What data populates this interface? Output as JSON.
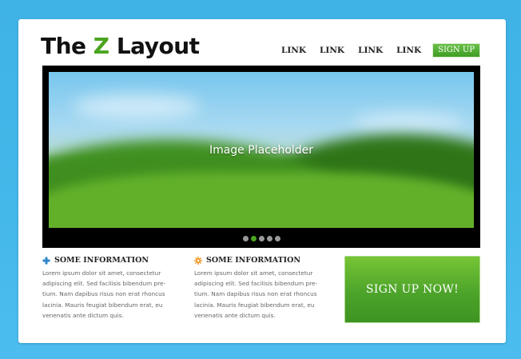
{
  "header": {
    "logo_prefix": "The ",
    "logo_accent": "Z",
    "logo_suffix": " Layout"
  },
  "nav": {
    "links": [
      "LINK",
      "LINK",
      "LINK",
      "LINK"
    ],
    "signup_label": "SIGN UP"
  },
  "slider": {
    "caption": "Image Placeholder",
    "dot_count": 5,
    "active_dot_index": 1
  },
  "info": [
    {
      "icon": "plus-icon",
      "title": "SOME INFORMATION",
      "body": "Lorem ipsum dolor sit amet, consectetur adipiscing elit. Sed facilisis bibendum pre-tium. Nam dapibus risus non erat rhoncus lacinia. Mauris feugiat bibendum erat, eu venenatis ante dictum quis."
    },
    {
      "icon": "gear-icon",
      "title": "SOME INFORMATION",
      "body": "Lorem ipsum dolor sit amet, consectetur adipiscing elit. Sed facilisis bibendum pre-tium. Nam dapibus risus non erat rhoncus lacinia. Mauris feugiat bibendum erat, eu venenatis ante dictum quis."
    }
  ],
  "cta": {
    "label": "SIGN UP NOW!"
  },
  "colors": {
    "background": "#45b8ea",
    "accent_green": "#4aa51f",
    "plus_icon": "#2f86c9",
    "gear_icon": "#f2a23a"
  }
}
